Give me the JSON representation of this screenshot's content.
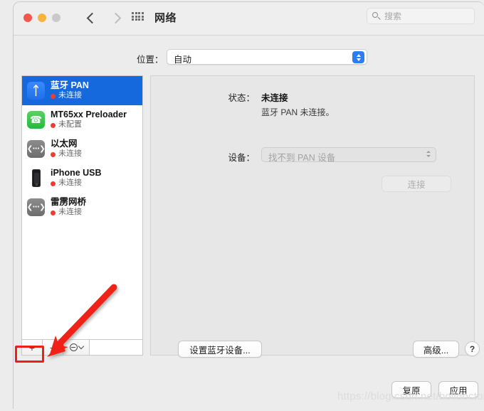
{
  "window": {
    "title": "网络",
    "traffic_lights": [
      "close",
      "minimize",
      "zoom"
    ],
    "back_icon": "chevron-left-icon",
    "forward_icon": "chevron-right-icon",
    "grid_icon": "grid-apps-icon",
    "search": {
      "placeholder": "搜索",
      "icon": "search-icon",
      "value": ""
    }
  },
  "location": {
    "label": "位置：",
    "value": "自动",
    "options": [
      "自动"
    ]
  },
  "sidebar": {
    "items": [
      {
        "name": "蓝牙 PAN",
        "status": "未连接",
        "icon": "bluetooth-icon",
        "selected": true
      },
      {
        "name": "MT65xx Preloader",
        "status": "未配置",
        "icon": "modem-icon",
        "selected": false
      },
      {
        "name": "以太网",
        "status": "未连接",
        "icon": "ethernet-icon",
        "selected": false
      },
      {
        "name": "iPhone USB",
        "status": "未连接",
        "icon": "iphone-icon",
        "selected": false
      },
      {
        "name": "雷雳网桥",
        "status": "未连接",
        "icon": "ethernet-icon",
        "selected": false
      }
    ],
    "toolbar": {
      "add_label": "+",
      "remove_label": "−",
      "action_label": "",
      "action_icon": "gear-action-icon"
    },
    "status_dot_color": "#f03d2e",
    "selected_row_color": "#1569dd"
  },
  "detail": {
    "status_label": "状态：",
    "status_value": "未连接",
    "status_description": "蓝牙 PAN 未连接。",
    "device_label": "设备：",
    "device_value": "找不到 PAN 设备",
    "connect_label": "连接",
    "bluetooth_setup_label": "设置蓝牙设备...",
    "advanced_label": "高级...",
    "help_label": "?"
  },
  "footer": {
    "revert_label": "复原",
    "apply_label": "应用"
  },
  "annotations": {
    "watermark": "https://blog.csdn.net/boildoctor",
    "highlight_color": "#ee2015",
    "arrow_target": "add-service-button"
  }
}
